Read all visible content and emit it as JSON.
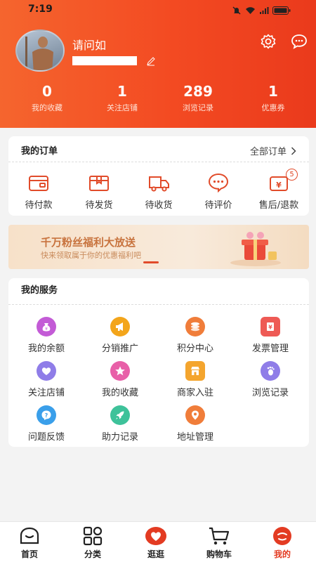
{
  "status_bar": {
    "time": "7:19"
  },
  "profile": {
    "username": "请问如"
  },
  "stats": [
    {
      "value": "0",
      "label": "我的收藏"
    },
    {
      "value": "1",
      "label": "关注店铺"
    },
    {
      "value": "289",
      "label": "浏览记录"
    },
    {
      "value": "1",
      "label": "优惠券"
    }
  ],
  "orders": {
    "title": "我的订单",
    "all_label": "全部订单",
    "items": [
      {
        "label": "待付款",
        "icon": "wallet-icon"
      },
      {
        "label": "待发货",
        "icon": "package-icon"
      },
      {
        "label": "待收货",
        "icon": "truck-icon"
      },
      {
        "label": "待评价",
        "icon": "comment-icon"
      },
      {
        "label": "售后/退款",
        "icon": "refund-icon",
        "badge": "5"
      }
    ]
  },
  "banner": {
    "title": "千万粉丝福利大放送",
    "subtitle": "快来领取属于你的优惠福利吧"
  },
  "services": {
    "title": "我的服务",
    "items": [
      {
        "label": "我的余额",
        "icon": "money-bag-icon",
        "color": "#c35bd6"
      },
      {
        "label": "分销推广",
        "icon": "megaphone-icon",
        "color": "#f3a51b"
      },
      {
        "label": "积分中心",
        "icon": "coins-icon",
        "color": "#f07d3a"
      },
      {
        "label": "发票管理",
        "icon": "invoice-icon",
        "color": "#ee5a55"
      },
      {
        "label": "关注店铺",
        "icon": "heart-icon",
        "color": "#8f7de8"
      },
      {
        "label": "我的收藏",
        "icon": "star-icon",
        "color": "#e860a8"
      },
      {
        "label": "商家入驻",
        "icon": "store-icon",
        "color": "#f4a52e"
      },
      {
        "label": "浏览记录",
        "icon": "footprint-icon",
        "color": "#8f7de8"
      },
      {
        "label": "问题反馈",
        "icon": "question-icon",
        "color": "#3a9fea"
      },
      {
        "label": "助力记录",
        "icon": "rocket-icon",
        "color": "#3ec29a"
      },
      {
        "label": "地址管理",
        "icon": "location-icon",
        "color": "#f07d3a"
      }
    ]
  },
  "tabbar": {
    "items": [
      {
        "label": "首页",
        "icon": "home-icon"
      },
      {
        "label": "分类",
        "icon": "category-icon"
      },
      {
        "label": "逛逛",
        "icon": "explore-icon"
      },
      {
        "label": "购物车",
        "icon": "cart-icon"
      },
      {
        "label": "我的",
        "icon": "profile-icon",
        "active": true
      }
    ]
  }
}
